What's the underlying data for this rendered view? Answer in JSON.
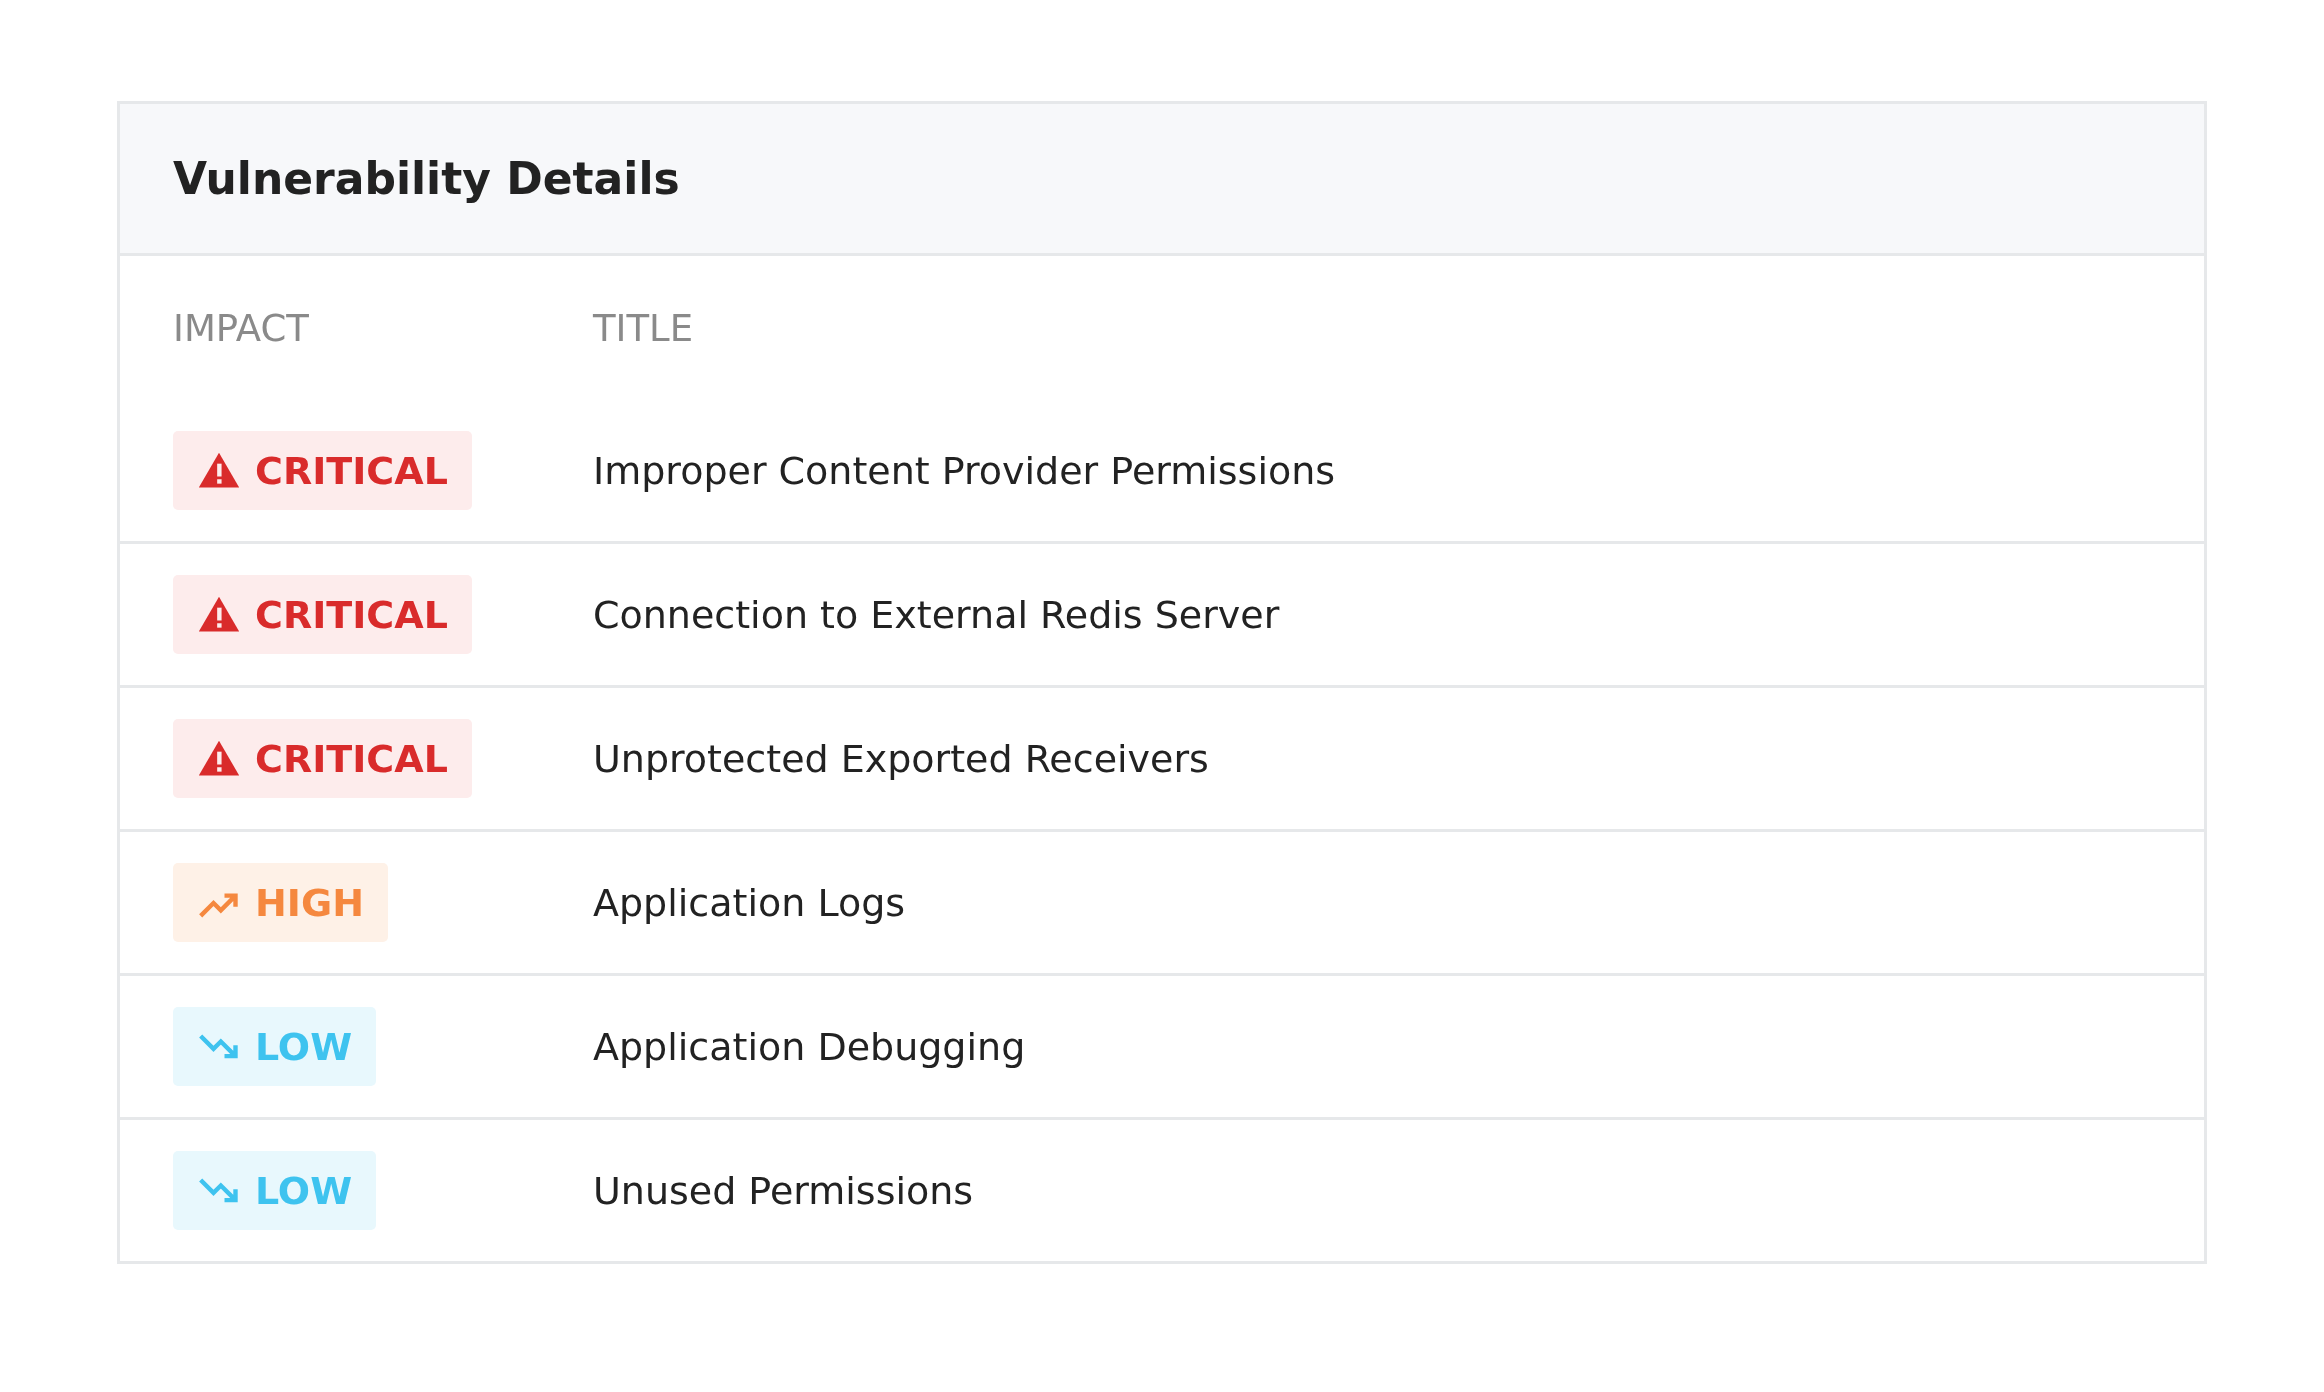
{
  "card": {
    "title": "Vulnerability Details"
  },
  "table": {
    "columns": [
      "IMPACT",
      "TITLE"
    ],
    "rows": [
      {
        "impact": {
          "kind": "critical",
          "label": "CRITICAL"
        },
        "title": "Improper Content Provider Permissions"
      },
      {
        "impact": {
          "kind": "critical",
          "label": "CRITICAL"
        },
        "title": "Connection to External Redis Server"
      },
      {
        "impact": {
          "kind": "critical",
          "label": "CRITICAL"
        },
        "title": "Unprotected Exported Receivers"
      },
      {
        "impact": {
          "kind": "high",
          "label": "HIGH"
        },
        "title": "Application Logs"
      },
      {
        "impact": {
          "kind": "low",
          "label": "LOW"
        },
        "title": "Application Debugging"
      },
      {
        "impact": {
          "kind": "low",
          "label": "LOW"
        },
        "title": "Unused Permissions"
      }
    ]
  }
}
